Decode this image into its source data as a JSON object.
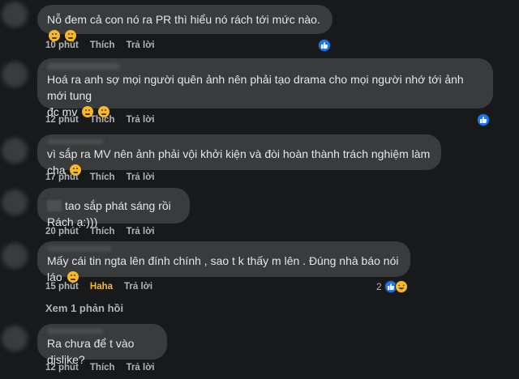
{
  "comments": [
    {
      "text": "Nỗ đem cả con nó ra PR thì hiểu nó rách tới mức nào.",
      "time": "10 phút",
      "like": "Thích",
      "reply": "Trả lời"
    },
    {
      "text1": "Hoá ra anh sợ mọi người quên ảnh nên phải tạo drama cho mọi người nhớ tới ảnh mới tung",
      "text2": "đc mv",
      "time": "12 phút",
      "like": "Thích",
      "reply": "Trả lời"
    },
    {
      "text": "vì sắp ra MV nên ảnh phải vội khởi kiện và đòi hoàn thành trách nghiệm làm cha",
      "time": "17 phút",
      "like": "Thích",
      "reply": "Trả lời"
    },
    {
      "text": "tao sắp phát sáng rồi Rách ạ:)))",
      "time": "20 phút",
      "like": "Thích",
      "reply": "Trả lời"
    },
    {
      "text": "Mấy cái tin ngta lên đính chính , sao t k thấy m lên . Đúng nhà báo nói láo",
      "time": "15 phút",
      "like": "Haha",
      "reply": "Trả lời",
      "reaction_count": "2"
    },
    {
      "text": "Ra chưa để t vào dislike?",
      "time": "12 phút",
      "like": "Thích",
      "reply": "Trả lời"
    }
  ],
  "view_replies": "Xem 1 phản hồi",
  "icons": {
    "like": "like-icon",
    "haha": "haha-icon",
    "emoji": "emoji-icon"
  },
  "colors": {
    "background": "#18191a",
    "bubble": "#3a3b3c",
    "meta": "#b0b3b8",
    "like": "#1877f2",
    "haha": "#f7b928"
  }
}
